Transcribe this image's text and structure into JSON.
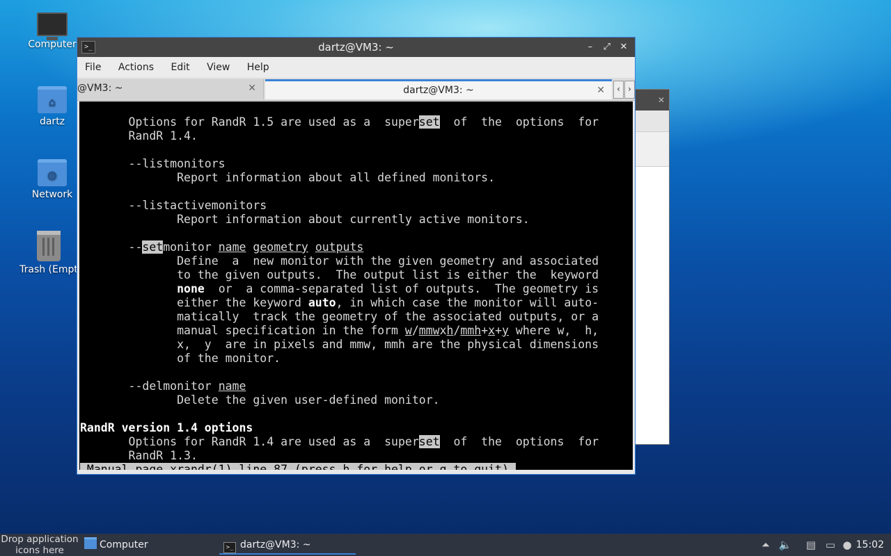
{
  "desktop": {
    "icons": [
      {
        "label": "Computer",
        "icon": "computer-icon"
      },
      {
        "label": "dartz",
        "icon": "home-folder-icon"
      },
      {
        "label": "Network",
        "icon": "network-folder-icon"
      },
      {
        "label": "Trash (Empt",
        "icon": "trash-icon"
      }
    ]
  },
  "window": {
    "title": "dartz@VM3: ~",
    "controls": {
      "minimize": "–",
      "maximize": "⤢",
      "close": "✕"
    },
    "menu": [
      "File",
      "Actions",
      "Edit",
      "View",
      "Help"
    ],
    "tabs": [
      {
        "label": "@VM3: ~",
        "close": "✕"
      },
      {
        "label": "dartz@VM3: ~",
        "close": "✕"
      }
    ],
    "tab_nav": {
      "prev": "‹",
      "next": "›"
    }
  },
  "terminal": {
    "l1a": "       Options for RandR 1.5 are used as a  super",
    "l1b": "set",
    "l1c": "  of  the  options  for",
    "l2": "       RandR 1.4.",
    "l4": "       --listmonitors",
    "l5": "              Report information about all defined monitors.",
    "l7": "       --listactivemonitors",
    "l8": "              Report information about currently active monitors.",
    "l10a": "       --",
    "l10b": "set",
    "l10c": "monitor ",
    "l10d": "name",
    "l10e": " ",
    "l10f": "geometry",
    "l10g": " ",
    "l10h": "outputs",
    "l11": "              Define  a  new monitor with the given geometry and associated",
    "l12": "              to the given outputs.  The output list is either the  keyword",
    "l13a": "              ",
    "l13b": "none",
    "l13c": "  or  a comma-separated list of outputs.  The geometry is",
    "l14a": "              either the keyword ",
    "l14b": "auto",
    "l14c": ", in which case the monitor will auto-",
    "l15": "              matically  track the geometry of the associated outputs, or a",
    "l16a": "              manual specification in the form ",
    "l16b": "w",
    "l16c": "/",
    "l16d": "mmw",
    "l16e": "x",
    "l16f": "h",
    "l16g": "/",
    "l16h": "mmh",
    "l16i": "+",
    "l16j": "x",
    "l16k": "+",
    "l16l": "y",
    "l16m": " where w,  h,",
    "l17": "              x,  y  are in pixels and mmw, mmh are the physical dimensions",
    "l18": "              of the monitor.",
    "l20a": "       --delmonitor ",
    "l20b": "name",
    "l21": "              Delete the given user-defined monitor.",
    "l23": "RandR version 1.4 options",
    "l24a": "       Options for RandR 1.4 are used as a  super",
    "l24b": "set",
    "l24c": "  of  the  options  for",
    "l25": "       RandR 1.3.",
    "status": " Manual page xrandr(1) line 87 (press h for help or q to quit)"
  },
  "taskbar": {
    "drop_hint": "Drop application icons here",
    "tasks": [
      {
        "label": "Computer",
        "icon": "folder-icon"
      },
      {
        "label": "dartz@VM3: ~",
        "icon": "terminal-icon"
      }
    ],
    "tray": [
      "up-arrow-icon",
      "volume-icon",
      "clipboard-icon",
      "network-icon",
      "notification-icon"
    ],
    "clock": "15:02"
  }
}
